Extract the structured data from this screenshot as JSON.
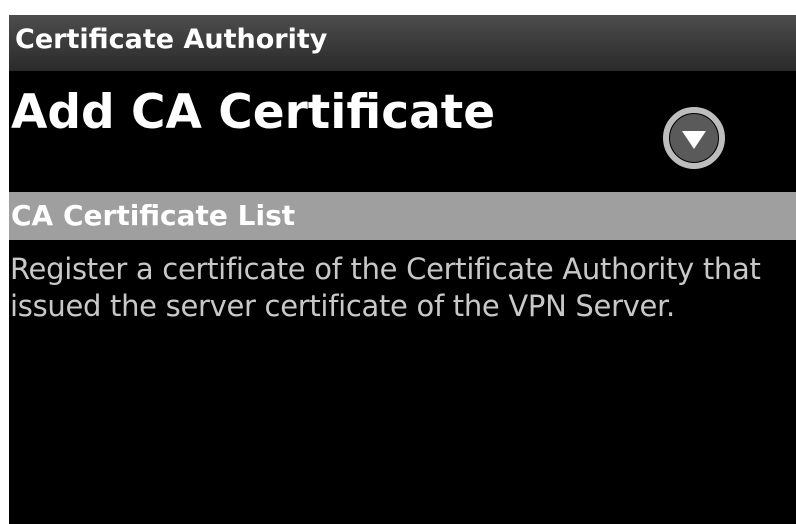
{
  "title_bar": {
    "title": "Certificate Authority"
  },
  "add_ca": {
    "label": "Add CA Certificate",
    "dropdown_icon": "chevron-down-circle-icon"
  },
  "section": {
    "header": "CA Certificate List",
    "description": "Register a certificate of the Certificate Authority that issued the server certificate of the VPN Server."
  },
  "colors": {
    "background": "#000000",
    "title_bar": "#3a3a3a",
    "section_header": "#9f9f9f",
    "text_primary": "#ffffff",
    "text_secondary": "#c8c8c8"
  }
}
